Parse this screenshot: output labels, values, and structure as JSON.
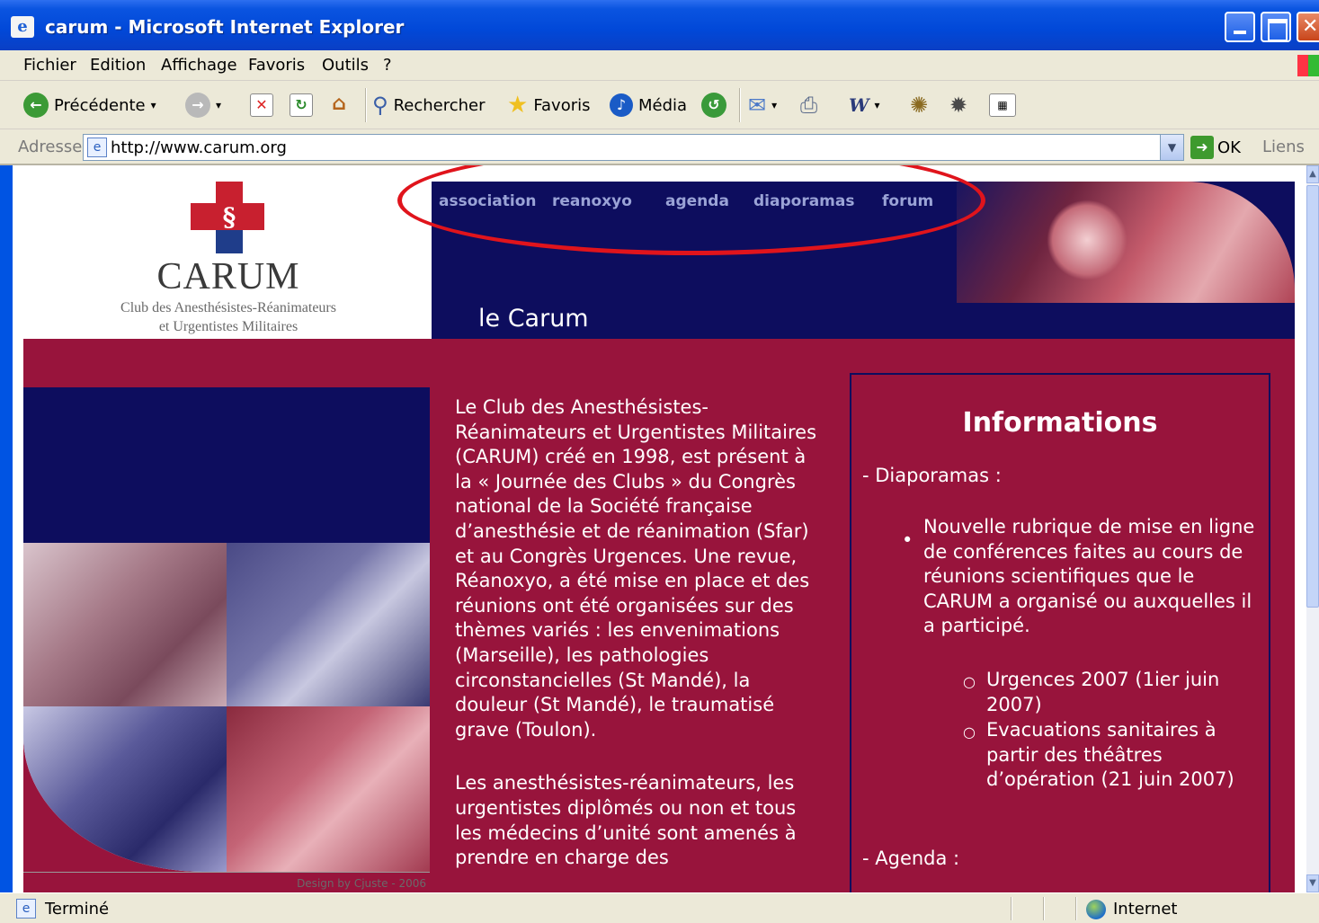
{
  "window": {
    "title": "carum - Microsoft Internet Explorer",
    "icon": "ie-page-icon",
    "controls": [
      "minimize",
      "maximize",
      "close"
    ]
  },
  "menu": {
    "items": [
      "Fichier",
      "Edition",
      "Affichage",
      "Favoris",
      "Outils",
      "?"
    ]
  },
  "toolbar": {
    "back_label": "Précédente",
    "search_label": "Rechercher",
    "favorites_label": "Favoris",
    "media_label": "Média"
  },
  "address": {
    "label": "Adresse",
    "url": "http://www.carum.org",
    "go_label": "OK",
    "links_label": "Liens"
  },
  "page": {
    "logo": {
      "name": "CARUM",
      "subtitle_line1": "Club des Anesthésistes-Réanimateurs",
      "subtitle_line2": "et Urgentistes Militaires"
    },
    "nav": [
      "association",
      "reanoxyo",
      "agenda",
      "diaporamas",
      "forum"
    ],
    "heading": "le Carum",
    "intro_p1": "Le Club des Anesthésistes-Réanimateurs et Urgentistes Militaires (CARUM) créé en 1998, est présent à la « Journée des Clubs » du Congrès national de la Société française d’anesthésie et de réanimation (Sfar) et au Congrès Urgences. Une revue, Réanoxyo, a été mise en place et des réunions ont été organisées sur des thèmes variés : les envenimations (Marseille), les pathologies circonstancielles (St Mandé), la douleur (St Mandé), le traumatisé grave (Toulon).",
    "intro_p2": "Les anesthésistes-réanimateurs, les urgentistes diplômés ou non et tous les médecins d’unité sont amenés à prendre en charge des",
    "design_credit": "Design by Cjuste - 2006",
    "info": {
      "title": "Informations",
      "diaporamas_label": "- Diaporamas :",
      "bullet_text": "Nouvelle rubrique de mise en ligne de conférences faites au cours de réunions scientifiques que le CARUM a organisé ou auxquelles il a participé.",
      "sub_items": [
        "Urgences 2007 (1ier juin 2007)",
        "Evacuations sanitaires à partir des théâtres d’opération (21 juin 2007)"
      ],
      "agenda_label": "- Agenda :"
    },
    "colors": {
      "crimson": "#98143c",
      "navy": "#0d0d5e",
      "annotation_red": "#e0141c"
    }
  },
  "status": {
    "text": "Terminé",
    "zone": "Internet"
  }
}
